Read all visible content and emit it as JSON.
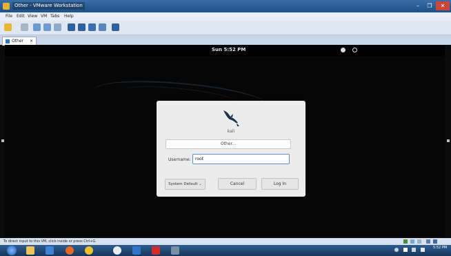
{
  "window": {
    "title": "Other - VMware Workstation",
    "minimize": "–",
    "maximize": "❐",
    "close": "✕"
  },
  "menu": [
    "File",
    "Edit",
    "View",
    "VM",
    "Tabs",
    "Help"
  ],
  "tab": {
    "label": "Other",
    "close": "×"
  },
  "vm": {
    "clock": "Sun 5:52 PM",
    "hostname": "kali",
    "user_selector": "Other...",
    "username_label": "Username:",
    "username_value": "root",
    "session_label": "System Default",
    "session_caret": "⌄",
    "cancel_label": "Cancel",
    "login_label": "Log In"
  },
  "statusbar": {
    "hint": "To direct input to this VM, click inside or press Ctrl+G."
  },
  "taskbar": {
    "time": "5:52 PM"
  },
  "colors": {
    "accent": "#2e74c9",
    "dialog_bg": "#ececec",
    "input_focus": "#5a8fd0"
  }
}
